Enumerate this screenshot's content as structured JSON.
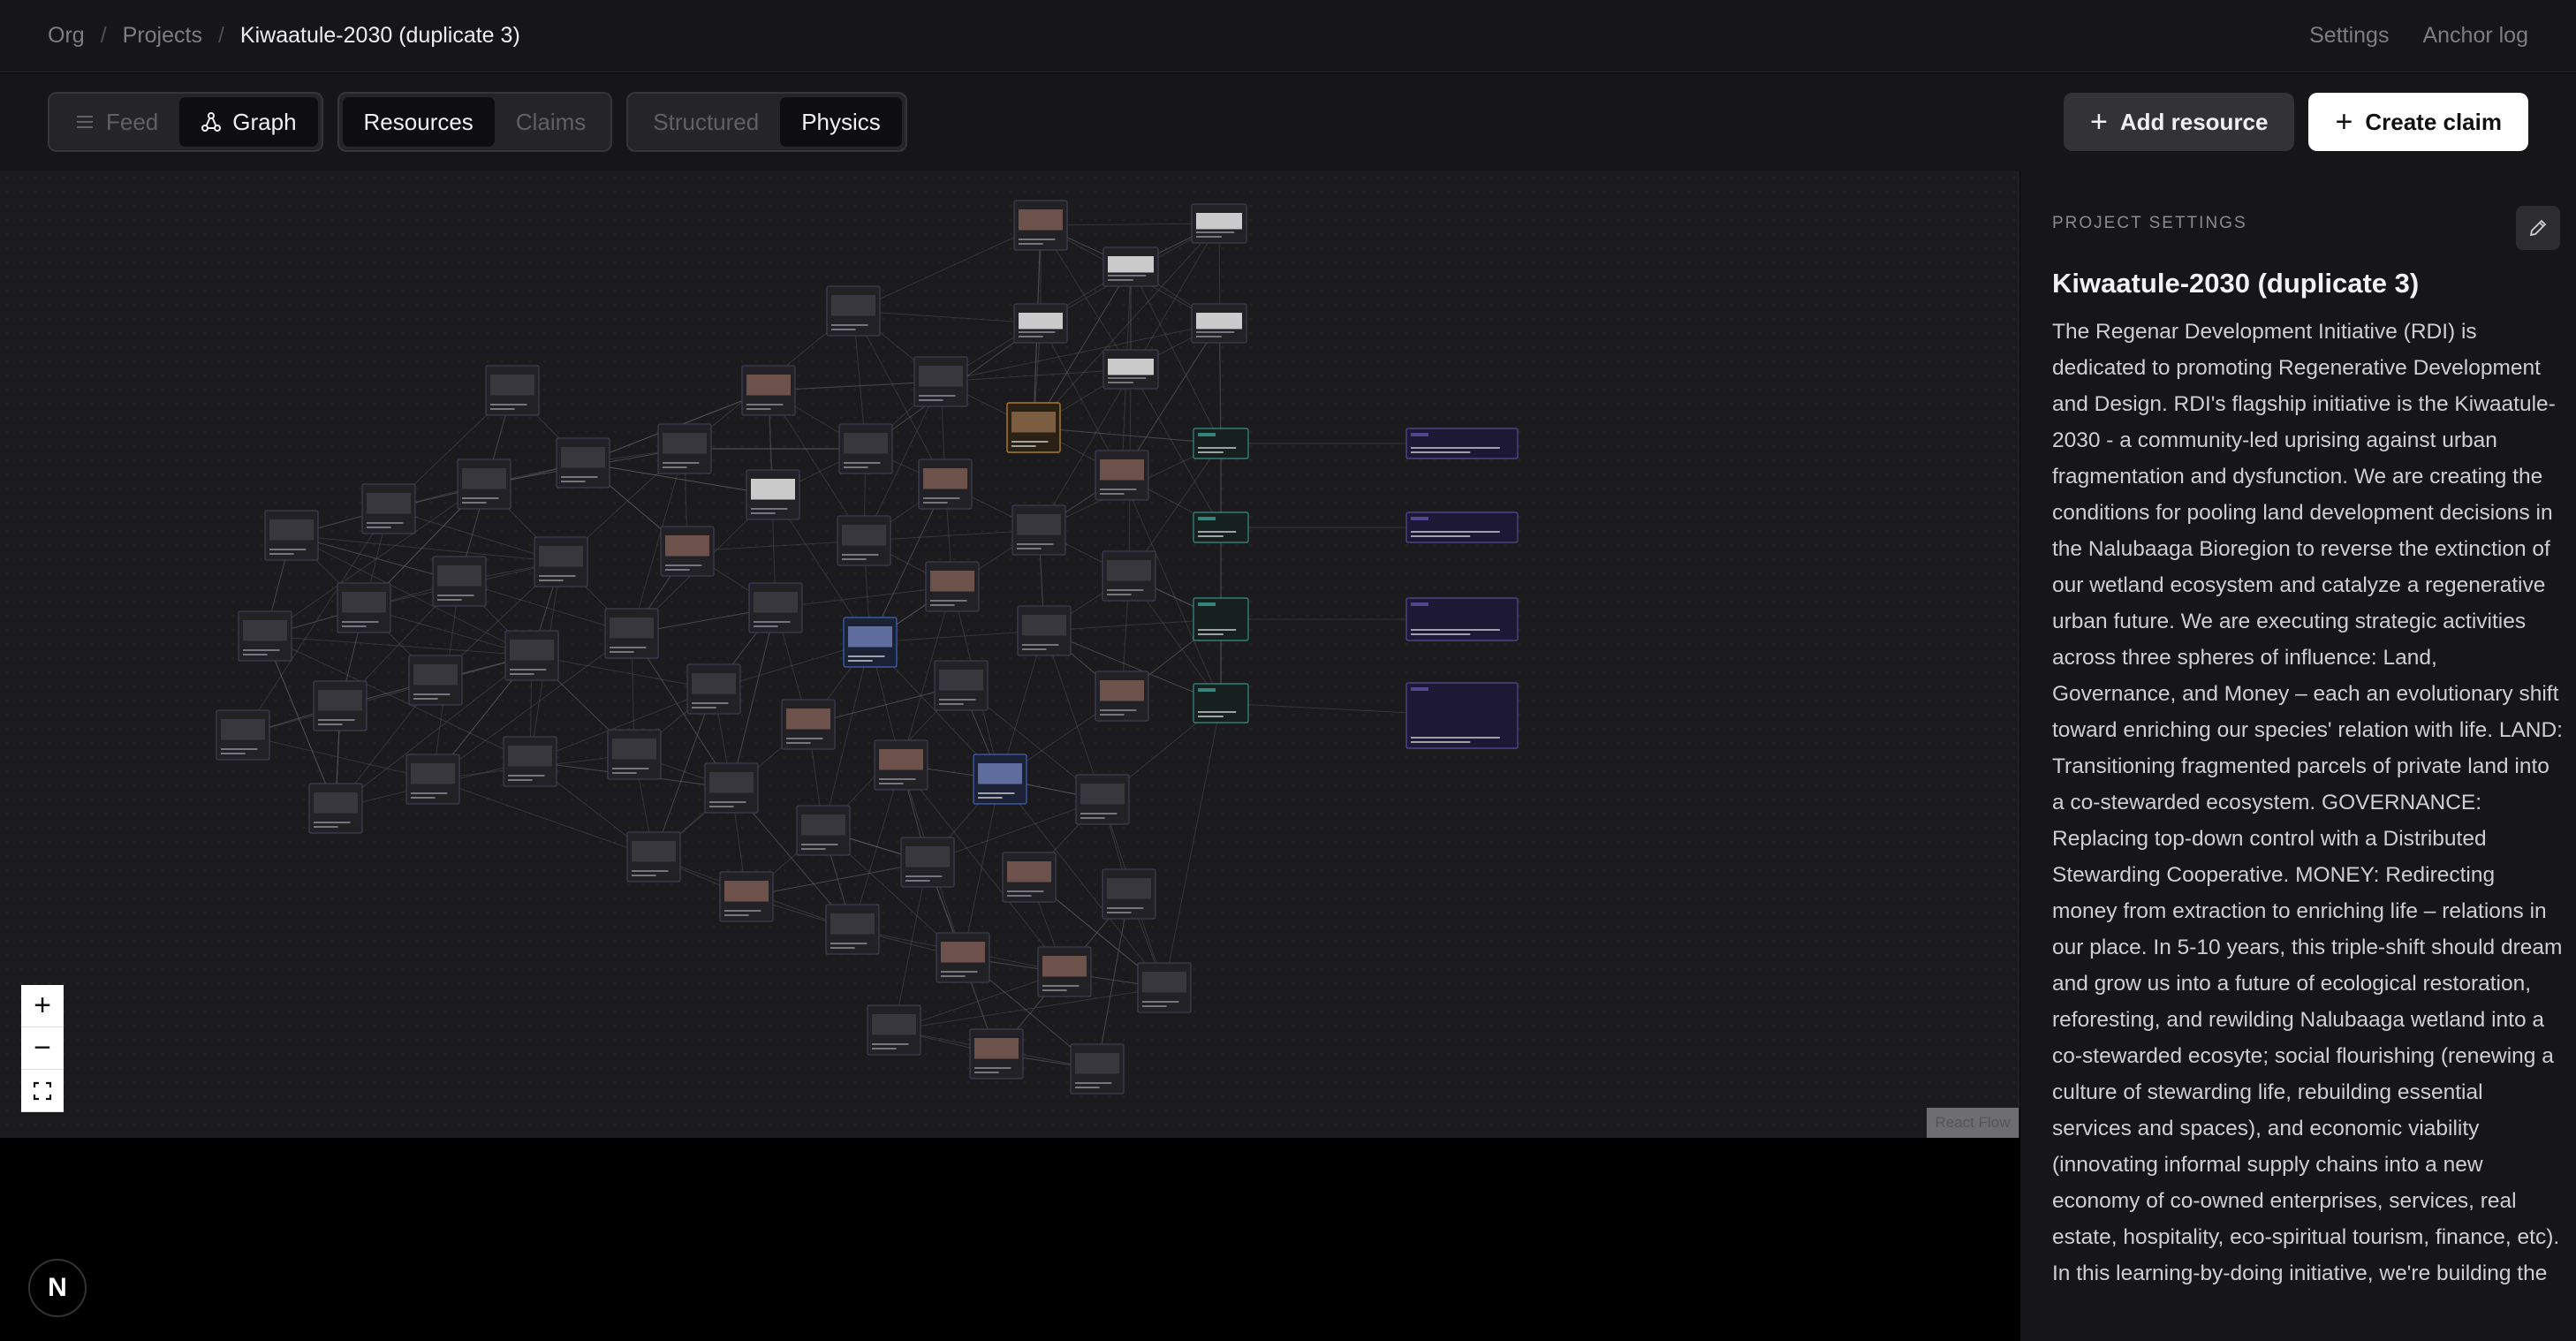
{
  "breadcrumb": {
    "items": [
      "Org",
      "Projects"
    ],
    "current": "Kiwaatule-2030 (duplicate 3)"
  },
  "topbar": {
    "settings_label": "Settings",
    "anchor_log_label": "Anchor log"
  },
  "toolbar": {
    "view_tabs": {
      "feed": "Feed",
      "graph": "Graph",
      "active": "graph"
    },
    "content_tabs": {
      "resources": "Resources",
      "claims": "Claims",
      "active": "resources"
    },
    "layout_tabs": {
      "structured": "Structured",
      "physics": "Physics",
      "active": "physics"
    },
    "add_resource_label": "Add resource",
    "create_claim_label": "Create claim"
  },
  "zoom": {
    "in": "+",
    "out": "−",
    "fit_icon": "fullscreen-icon",
    "badge": "React Flow"
  },
  "panel": {
    "eyebrow": "PROJECT SETTINGS",
    "title": "Kiwaatule-2030 (duplicate 3)",
    "description": "The Regenar Development Initiative (RDI) is dedicated to promoting Regenerative Development and Design. RDI's flagship initiative is the Kiwaatule-2030 - a community-led uprising against urban fragmentation and dysfunction. We are creating the conditions for pooling land development decisions in the Nalubaaga Bioregion to reverse the extinction of our wetland ecosystem and catalyze a regenerative urban future. We are executing strategic activities across three spheres of influence: Land, Governance, and Money – each an evolutionary shift toward enriching our species' relation with life. LAND: Transitioning fragmented parcels of private land into a co-stewarded ecosystem. GOVERNANCE: Replacing top-down control with a Distributed Stewarding Cooperative. MONEY: Redirecting money from extraction to enriching life – relations in our place. In 5-10 years, this triple-shift should dream and grow us into a future of ecological restoration, reforesting, and rewilding Nalubaaga wetland into a co-stewarded ecosyte; social flourishing (renewing a culture of stewarding life, rebuilding essential services and spaces), and economic viability (innovating informal supply chains into a new economy of co-owned enterprises, services, real estate, hospitality, eco-spiritual tourism, finance, etc). In this learning-by-doing initiative, we're building the"
  },
  "logo": {
    "letter": "N"
  },
  "colors": {
    "accent_teal": "#3a8f86",
    "accent_purple": "#5a4a9a",
    "accent_orange": "#c78a2a",
    "accent_blue": "#3f63b8"
  }
}
